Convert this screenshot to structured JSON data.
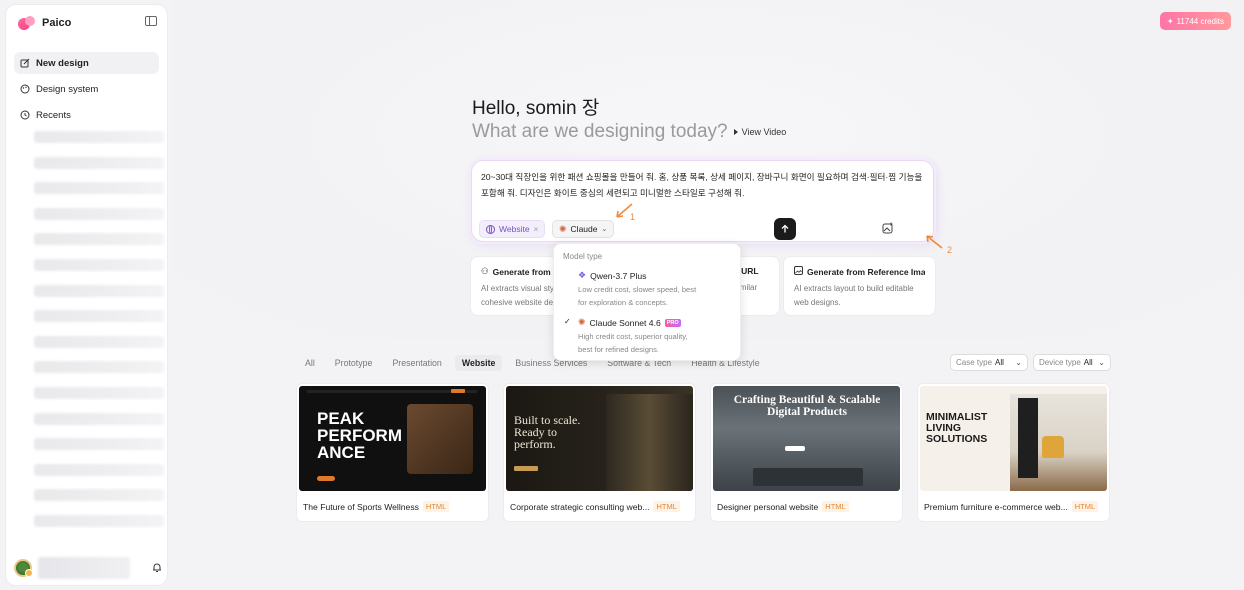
{
  "sidebar": {
    "brand": "Paico",
    "nav": {
      "new_design": "New design",
      "design_system": "Design system",
      "recents": "Recents"
    }
  },
  "header": {
    "credits": "11744 credits"
  },
  "hero": {
    "greeting": "Hello, somin 장",
    "subtitle": "What are we designing today?",
    "view_video": "View Video"
  },
  "prompt": {
    "text": "20~30대 직장인을 위한 패션 쇼핑몰을 만들어 줘. 홈, 상품 목록, 상세 페이지, 장바구니 화면이 필요하며 검색·필터·찜 기능을 포함해 줘. 디자인은 화이트 중심의 세련되고 미니멀한 스타일로 구성해 줘.",
    "website_chip": "Website",
    "model_chip": "Claude"
  },
  "annotations": {
    "one": "1",
    "two": "2"
  },
  "gen_cards": [
    {
      "title": "Generate from B",
      "desc1": "AI extracts visual sty",
      "desc2": "cohesive website de"
    },
    {
      "title": "e URL",
      "desc1": "similar",
      "desc2": ""
    },
    {
      "title": "Generate from Reference Image",
      "desc1": "AI extracts layout to build editable",
      "desc2": "web designs."
    }
  ],
  "dropdown": {
    "heading": "Model type",
    "options": [
      {
        "title": "Qwen-3.7 Plus",
        "desc1": "Low credit cost, slower speed, best",
        "desc2": "for exploration & concepts.",
        "selected": false
      },
      {
        "title": "Claude Sonnet 4.6",
        "badge": "PRO",
        "desc1": "High credit cost, superior quality,",
        "desc2": "best for refined designs.",
        "selected": true
      }
    ]
  },
  "tabs": [
    "All",
    "Prototype",
    "Presentation",
    "Website",
    "Business Services",
    "Software & Tech",
    "Health & Lifestyle"
  ],
  "active_tab": "Website",
  "filters": {
    "case_type_label": "Case type",
    "case_type_value": "All",
    "device_type_label": "Device type",
    "device_type_value": "All"
  },
  "templates": [
    {
      "title": "The Future of Sports Wellness",
      "badge": "HTML",
      "thumb_text": "PEAK PERFORM ANCE"
    },
    {
      "title": "Corporate strategic consulting web...",
      "badge": "HTML",
      "thumb_text": "Built to scale. Ready to perform."
    },
    {
      "title": "Designer personal website",
      "badge": "HTML",
      "thumb_text": "Crafting Beautiful & Scalable Digital Products"
    },
    {
      "title": "Premium furniture e-commerce web...",
      "badge": "HTML",
      "thumb_text": "MINIMALIST LIVING SOLUTIONS"
    }
  ],
  "colors": {
    "accent": "#ff74a6",
    "annotation": "#f08a3a",
    "purple": "#7b52c4"
  }
}
